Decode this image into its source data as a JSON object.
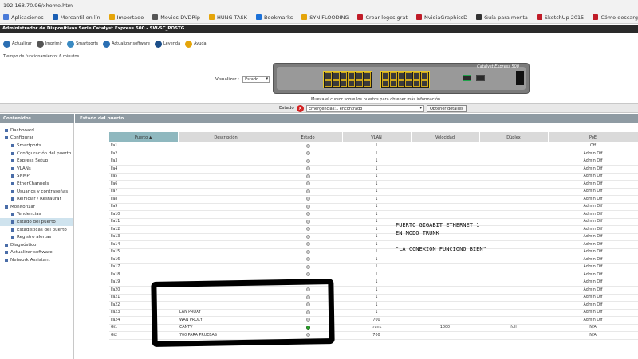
{
  "browser": {
    "url": "192.168.70.96/xhome.htm",
    "bookmarks": [
      {
        "label": "Aplicaciones",
        "color": "#4a7bd8"
      },
      {
        "label": "Mercantil en lín",
        "color": "#1a5fb4"
      },
      {
        "label": "Importado",
        "color": "#e5a50a"
      },
      {
        "label": "Movies-DVDRip",
        "color": "#555555"
      },
      {
        "label": "HUNG TASK",
        "color": "#e5a50a"
      },
      {
        "label": "Bookmarks",
        "color": "#1c71d8"
      },
      {
        "label": "SYN FLOODING",
        "color": "#e5a50a"
      },
      {
        "label": "Crear logos grat",
        "color": "#c01c28"
      },
      {
        "label": "NvidiaGraphicsD",
        "color": "#c01c28"
      },
      {
        "label": "Guía para monta",
        "color": "#333333"
      },
      {
        "label": "SketchUp 2015",
        "color": "#c01c28"
      },
      {
        "label": "Cómo descargar",
        "color": "#c01c28"
      }
    ]
  },
  "app": {
    "title": "Administrador de Dispositivos Serie Catalyst Express 500 - SW-SC_POSTG",
    "toolbar": [
      {
        "label": "Actualizar",
        "color": "#2b6fb3"
      },
      {
        "label": "Imprimir",
        "color": "#555555"
      },
      {
        "label": "Smartports",
        "color": "#3a8ac2"
      },
      {
        "label": "Actualizar software",
        "color": "#2b6fb3"
      },
      {
        "label": "Leyenda",
        "color": "#1c4f8a"
      },
      {
        "label": "Ayuda",
        "color": "#e5a50a"
      }
    ],
    "uptime": "Tiempo de funcionamiento: 6 minutos",
    "switch_title": "Catalyst Express 500",
    "visual_label": "Visualizar :",
    "visual_value": "Estado",
    "hint": "Mueva el cursor sobre los puertos para obtener más información.",
    "status_label": "Estado",
    "status_value": "Emergencias:1 encontrado",
    "status_button": "Obtener detalles"
  },
  "nav": {
    "header": "Contenidos",
    "items": [
      {
        "label": "Dashboard",
        "sub": false
      },
      {
        "label": "Configurar",
        "sub": false
      },
      {
        "label": "Smartports",
        "sub": true
      },
      {
        "label": "Configuración del puerto",
        "sub": true
      },
      {
        "label": "Express Setup",
        "sub": true
      },
      {
        "label": "VLANs",
        "sub": true
      },
      {
        "label": "SNMP",
        "sub": true
      },
      {
        "label": "EtherChannels",
        "sub": true
      },
      {
        "label": "Usuarios y contraseñas",
        "sub": true
      },
      {
        "label": "Reiniciar / Restaurar",
        "sub": true
      },
      {
        "label": "Monitorizar",
        "sub": false
      },
      {
        "label": "Tendencias",
        "sub": true
      },
      {
        "label": "Estado del puerto",
        "sub": true,
        "active": true
      },
      {
        "label": "Estadísticas del puerto",
        "sub": true
      },
      {
        "label": "Registro alertas",
        "sub": true
      },
      {
        "label": "Diagnóstico",
        "sub": false
      },
      {
        "label": "Actualizar software",
        "sub": false
      },
      {
        "label": "Network Assistant",
        "sub": false
      }
    ]
  },
  "main": {
    "header": "Estado del puerto",
    "columns": [
      "Puerto ▲",
      "Descripción",
      "Estado",
      "VLAN",
      "Velocidad",
      "Dúplex",
      "PoE"
    ],
    "rows": [
      {
        "port": "Fa1",
        "desc": "",
        "up": false,
        "vlan": "1",
        "speed": "",
        "duplex": "",
        "poe": "Off"
      },
      {
        "port": "Fa2",
        "desc": "",
        "up": false,
        "vlan": "1",
        "speed": "",
        "duplex": "",
        "poe": "Admin Off"
      },
      {
        "port": "Fa3",
        "desc": "",
        "up": false,
        "vlan": "1",
        "speed": "",
        "duplex": "",
        "poe": "Admin Off"
      },
      {
        "port": "Fa4",
        "desc": "",
        "up": false,
        "vlan": "1",
        "speed": "",
        "duplex": "",
        "poe": "Admin Off"
      },
      {
        "port": "Fa5",
        "desc": "",
        "up": false,
        "vlan": "1",
        "speed": "",
        "duplex": "",
        "poe": "Admin Off"
      },
      {
        "port": "Fa6",
        "desc": "",
        "up": false,
        "vlan": "1",
        "speed": "",
        "duplex": "",
        "poe": "Admin Off"
      },
      {
        "port": "Fa7",
        "desc": "",
        "up": false,
        "vlan": "1",
        "speed": "",
        "duplex": "",
        "poe": "Admin Off"
      },
      {
        "port": "Fa8",
        "desc": "",
        "up": false,
        "vlan": "1",
        "speed": "",
        "duplex": "",
        "poe": "Admin Off"
      },
      {
        "port": "Fa9",
        "desc": "",
        "up": false,
        "vlan": "1",
        "speed": "",
        "duplex": "",
        "poe": "Admin Off"
      },
      {
        "port": "Fa10",
        "desc": "",
        "up": false,
        "vlan": "1",
        "speed": "",
        "duplex": "",
        "poe": "Admin Off"
      },
      {
        "port": "Fa11",
        "desc": "",
        "up": false,
        "vlan": "1",
        "speed": "",
        "duplex": "",
        "poe": "Admin Off"
      },
      {
        "port": "Fa12",
        "desc": "",
        "up": false,
        "vlan": "1",
        "speed": "",
        "duplex": "",
        "poe": "Admin Off"
      },
      {
        "port": "Fa13",
        "desc": "",
        "up": false,
        "vlan": "1",
        "speed": "",
        "duplex": "",
        "poe": "Admin Off"
      },
      {
        "port": "Fa14",
        "desc": "",
        "up": false,
        "vlan": "1",
        "speed": "",
        "duplex": "",
        "poe": "Admin Off"
      },
      {
        "port": "Fa15",
        "desc": "",
        "up": false,
        "vlan": "1",
        "speed": "",
        "duplex": "",
        "poe": "Admin Off"
      },
      {
        "port": "Fa16",
        "desc": "",
        "up": false,
        "vlan": "1",
        "speed": "",
        "duplex": "",
        "poe": "Admin Off"
      },
      {
        "port": "Fa17",
        "desc": "",
        "up": false,
        "vlan": "1",
        "speed": "",
        "duplex": "",
        "poe": "Admin Off"
      },
      {
        "port": "Fa18",
        "desc": "",
        "up": false,
        "vlan": "1",
        "speed": "",
        "duplex": "",
        "poe": "Admin Off"
      },
      {
        "port": "Fa19",
        "desc": "",
        "up": false,
        "vlan": "1",
        "speed": "",
        "duplex": "",
        "poe": "Admin Off"
      },
      {
        "port": "Fa20",
        "desc": "",
        "up": false,
        "vlan": "1",
        "speed": "",
        "duplex": "",
        "poe": "Admin Off"
      },
      {
        "port": "Fa21",
        "desc": "",
        "up": false,
        "vlan": "1",
        "speed": "",
        "duplex": "",
        "poe": "Admin Off"
      },
      {
        "port": "Fa22",
        "desc": "",
        "up": false,
        "vlan": "1",
        "speed": "",
        "duplex": "",
        "poe": "Admin Off"
      },
      {
        "port": "Fa23",
        "desc": "LAN PROXY",
        "up": false,
        "vlan": "1",
        "speed": "",
        "duplex": "",
        "poe": "Admin Off"
      },
      {
        "port": "Fa24",
        "desc": "WAN PROXY",
        "up": false,
        "vlan": "700",
        "speed": "",
        "duplex": "",
        "poe": "Admin Off"
      },
      {
        "port": "Gi1",
        "desc": "CANTV",
        "up": true,
        "vlan": "trunk",
        "speed": "1000",
        "duplex": "full",
        "poe": "N/A"
      },
      {
        "port": "Gi2",
        "desc": "700 PARA PRUEBAS",
        "up": false,
        "vlan": "700",
        "speed": "",
        "duplex": "",
        "poe": "N/A"
      }
    ]
  },
  "annotation": {
    "line1": "PUERTO GIGABIT ETHERNET 1",
    "line2": "EN MODO TRUNK",
    "line3": "\"LA CONEXION FUNCIONO BIEN\""
  }
}
